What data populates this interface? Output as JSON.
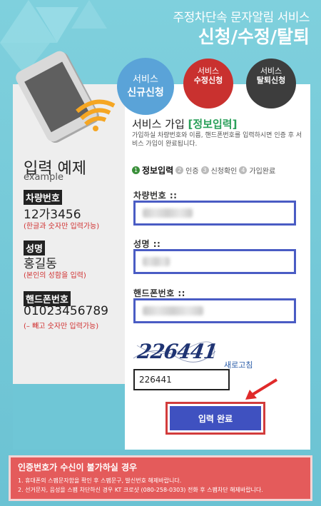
{
  "header": {
    "subtitle": "주정차단속 문자알림 서비스",
    "title": "신청/수정/탈퇴"
  },
  "tabs": [
    {
      "line1": "서비스",
      "line2": "신규신청"
    },
    {
      "line1": "서비스",
      "line2": "수정신청"
    },
    {
      "line1": "서비스",
      "line2": "탈퇴신청"
    }
  ],
  "example": {
    "title": "입력 예제",
    "subtitle": "example",
    "items": [
      {
        "label": "차량번호",
        "value": "12가3456",
        "note": "(한글과 숫자만 입력가능)"
      },
      {
        "label": "성명",
        "value": "홍길동",
        "note": "(본인의 성함을 입력)"
      },
      {
        "label": "핸드폰번호",
        "value": "01023456789",
        "note": "(– 빼고 숫자만 입력가능)"
      }
    ]
  },
  "form": {
    "title_prefix": "서비스 가입 ",
    "title_highlight": "[정보입력]",
    "description": "가입하실 차량번호와 이름, 핸드폰번호를 입력하시면 인증 후 서비스 가입이 완료됩니다.",
    "steps": [
      {
        "num": "1",
        "label": "정보입력"
      },
      {
        "num": "2",
        "label": "인증"
      },
      {
        "num": "3",
        "label": "신청확인"
      },
      {
        "num": "4",
        "label": "가입완료"
      }
    ],
    "fields": [
      {
        "label": "차량번호 ::"
      },
      {
        "label": "성명 ::"
      },
      {
        "label": "핸드폰번호 ::"
      }
    ],
    "captcha_text": "226441",
    "refresh_label": "새로고침",
    "captcha_value": "226441",
    "submit_label": "입력 완료"
  },
  "notice": {
    "title": "인증번호가 수신이 불가하실 경우",
    "items": [
      "1. 휴대폰의 스팸문자함을 확인 후 스팸문구, 발신번호 해제바랍니다.",
      "2. 선거문자, 음성을 스팸 차단하신 경우 KT 크로샷 (080-258-0303) 전화 후 스팸차단 해제바랍니다."
    ]
  },
  "colors": {
    "background": "#6fc6d6",
    "tab_new": "#5aa3d8",
    "tab_edit": "#c9312f",
    "tab_cancel": "#3d3d3d",
    "accent_blue": "#3f51c0",
    "highlight_red": "#d23c3c",
    "notice_red": "#e45b5b"
  }
}
